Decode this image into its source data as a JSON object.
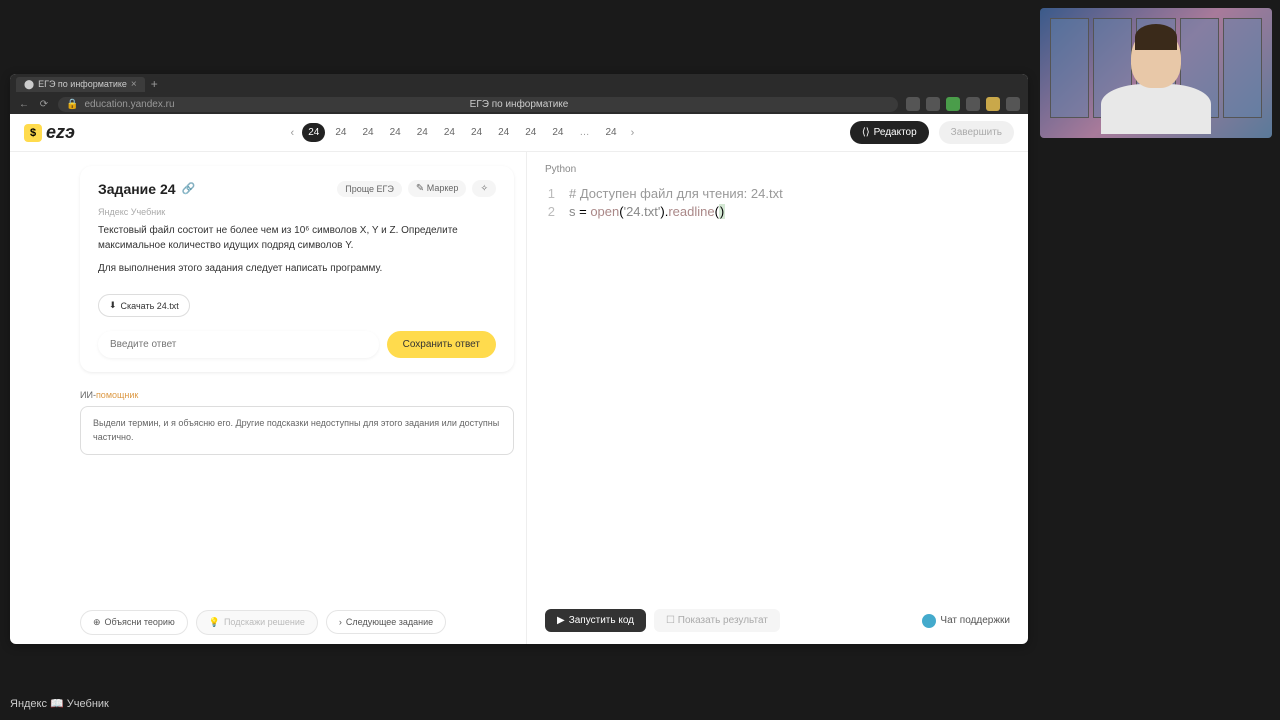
{
  "browser": {
    "tab_title": "ЕГЭ по информатике",
    "url": "education.yandex.ru",
    "page_title": "ЕГЭ по информатике"
  },
  "header": {
    "logo_badge": "$",
    "logo_text": "еzэ",
    "tasks": [
      "24",
      "24",
      "24",
      "24",
      "24",
      "24",
      "24",
      "24",
      "24",
      "24",
      "24"
    ],
    "editor_btn": "Редактор",
    "finish_btn": "Завершить"
  },
  "task": {
    "title": "Задание 24",
    "tag_source": "Проще ЕГЭ",
    "tag_marker": "Маркер",
    "source_label": "Яндекс Учебник",
    "text1": "Текстовый файл состоит не более чем из 10⁶ символов X, Y и Z. Определите максимальное количество идущих подряд символов Y.",
    "text2": "Для выполнения этого задания следует написать программу.",
    "download": "Скачать 24.txt",
    "answer_placeholder": "Введите ответ",
    "save_btn": "Сохранить ответ"
  },
  "ai": {
    "label_a": "ИИ-",
    "label_b": "помощник",
    "hint": "Выдели термин, и я объясню его. Другие подсказки недоступны для этого задания или доступны частично."
  },
  "code": {
    "language": "Python",
    "line1_comment": "# Доступен файл для чтения: 24.txt",
    "line2": "s = open('24.txt').readline()"
  },
  "bottom": {
    "theory": "Объясни теорию",
    "hint": "Подскажи решение",
    "next": "Следующее задание",
    "run": "Запустить код",
    "result": "Показать результат",
    "chat": "Чат поддержки"
  },
  "footer": {
    "brand": "Яндекс 📖 Учебник"
  }
}
